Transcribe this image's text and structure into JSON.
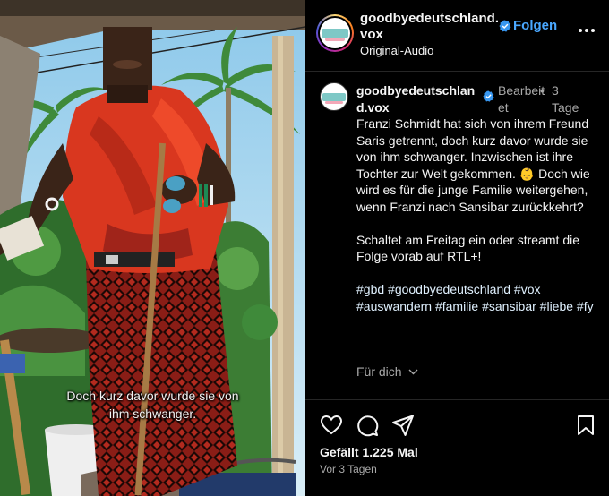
{
  "video": {
    "subtitle_line1": "Doch kurz davor wurde sie von",
    "subtitle_line2": "ihm schwanger."
  },
  "header": {
    "username_line1": "goodbyedeutschland.",
    "username_line2": "vox",
    "audio_label": "Original-Audio",
    "follow_label": "Folgen",
    "verified_icon": "verified-badge-icon",
    "more_icon": "more-options-icon"
  },
  "caption": {
    "username_line1": "goodbyedeutschlan",
    "username_line2": "d.vox",
    "edited_line1": "Bearbeit",
    "edited_line2": "et",
    "dot": "•",
    "age_line1": "3",
    "age_line2": "Tage",
    "paragraph1": "Franzi Schmidt hat sich von ihrem Freund Saris getrennt, doch kurz davor wurde sie von ihm schwanger. Inzwischen ist ihre Tochter zur Welt gekommen. 👶 Doch wie wird es für die junge Familie weitergehen, wenn Franzi nach Sansibar zurückkehrt?",
    "paragraph2": "Schaltet am Freitag ein oder streamt die Folge vorab auf RTL+!",
    "hashtags": "#gbd #goodbyedeutschland #vox #auswandern #familie #sansibar #liebe #fy",
    "for_you_label": "Für dich"
  },
  "actions": {
    "like_icon": "heart-icon",
    "comment_icon": "comment-icon",
    "share_icon": "send-icon",
    "save_icon": "bookmark-icon",
    "likes_text": "Gefällt 1.225 Mal",
    "time_text": "Vor 3 Tagen"
  },
  "colors": {
    "background": "#000000",
    "link_blue": "#4aa8ff",
    "verified_blue": "#3897f0",
    "muted_text": "#a8a8a8"
  }
}
